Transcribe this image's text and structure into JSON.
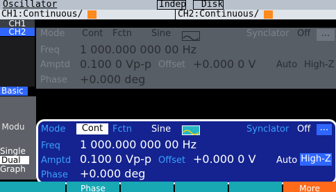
{
  "topbar": {
    "tab_oscillator": "Oscillator",
    "indep": "Indep",
    "disk": "Disk"
  },
  "status": {
    "ch1": "CH1:Continuous/",
    "ch2": "CH2:Continuous/"
  },
  "left": {
    "ch1": "CH1",
    "ch2": "CH2",
    "basic": "Basic",
    "modu": "Modu",
    "single": "Single",
    "dual": "Dual",
    "graph": "Graph"
  },
  "ch1": {
    "mode_label": "Mode",
    "mode_cont": "Cont",
    "mode_fctn": "Fctn",
    "mode_sine": "Sine",
    "synclator_label": "Synclator",
    "synclator_value": "Off",
    "more": "...",
    "freq_label": "Freq",
    "freq_value": "1 000.000 000 00 Hz",
    "amptd_label": "Amptd",
    "amptd_value": "0.100 0 Vp-p",
    "offset_label": "Offset",
    "offset_value": "+0.000 0 V",
    "auto": "Auto",
    "highz": "High-Z",
    "phase_label": "Phase",
    "phase_value": "+0.000 deg"
  },
  "ch2": {
    "mode_label": "Mode",
    "mode_cont": "Cont",
    "mode_fctn": "Fctn",
    "mode_sine": "Sine",
    "synclator_label": "Synclator",
    "synclator_value": "Off",
    "more": "...",
    "freq_label": "Freq",
    "freq_value": "1 000.000 000 00 Hz",
    "amptd_label": "Amptd",
    "amptd_value": "0.100 0 Vp-p",
    "offset_label": "Offset",
    "offset_value": "+0.000 0 V",
    "auto": "Auto",
    "highz": "High-Z",
    "phase_label": "Phase",
    "phase_value": "+0.000 deg"
  },
  "softkeys": {
    "phase": "Phase",
    "more": "More"
  },
  "icons": {
    "sine": "sine-wave-icon"
  },
  "colors": {
    "accent_blue": "#2f66ff",
    "panel_blue": "#14238f",
    "orange": "#ff8a1d"
  }
}
